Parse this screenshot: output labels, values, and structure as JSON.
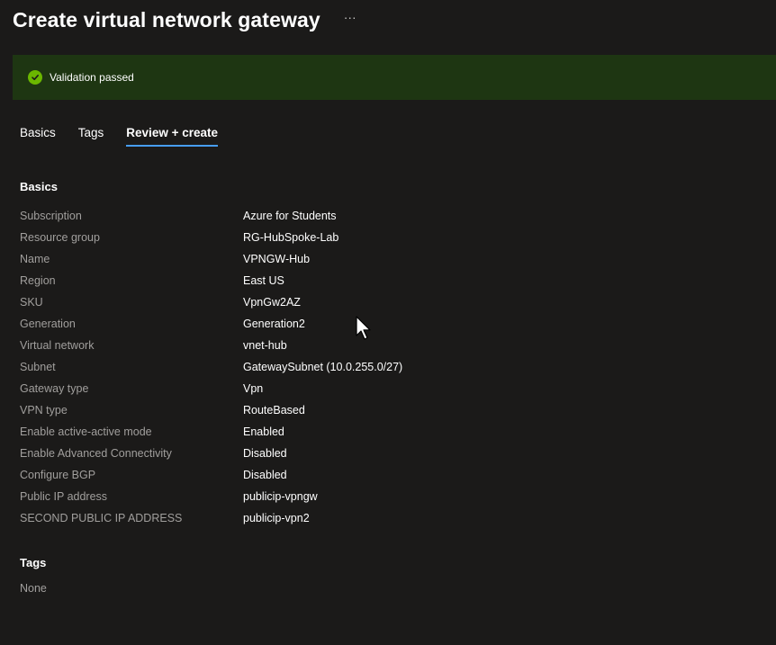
{
  "header": {
    "title": "Create virtual network gateway",
    "more_label": "···"
  },
  "banner": {
    "icon": "check-circle-icon",
    "text": "Validation passed",
    "color": "#1e3612"
  },
  "tabs": [
    {
      "label": "Basics",
      "active": false
    },
    {
      "label": "Tags",
      "active": false
    },
    {
      "label": "Review + create",
      "active": true
    }
  ],
  "basics": {
    "heading": "Basics",
    "rows": [
      {
        "label": "Subscription",
        "value": "Azure for Students"
      },
      {
        "label": "Resource group",
        "value": "RG-HubSpoke-Lab"
      },
      {
        "label": "Name",
        "value": "VPNGW-Hub"
      },
      {
        "label": "Region",
        "value": "East US"
      },
      {
        "label": "SKU",
        "value": "VpnGw2AZ"
      },
      {
        "label": "Generation",
        "value": "Generation2"
      },
      {
        "label": "Virtual network",
        "value": "vnet-hub"
      },
      {
        "label": "Subnet",
        "value": "GatewaySubnet (10.0.255.0/27)"
      },
      {
        "label": "Gateway type",
        "value": "Vpn"
      },
      {
        "label": "VPN type",
        "value": "RouteBased"
      },
      {
        "label": "Enable active-active mode",
        "value": "Enabled"
      },
      {
        "label": "Enable Advanced Connectivity",
        "value": "Disabled"
      },
      {
        "label": "Configure BGP",
        "value": "Disabled"
      },
      {
        "label": "Public IP address",
        "value": "publicip-vpngw"
      },
      {
        "label": "SECOND PUBLIC IP ADDRESS",
        "value": "publicip-vpn2"
      }
    ]
  },
  "tags": {
    "heading": "Tags",
    "value": "None"
  },
  "colors": {
    "background": "#1b1a19",
    "accent": "#479ef5",
    "success": "#6bb700",
    "label": "#a19f9d"
  }
}
